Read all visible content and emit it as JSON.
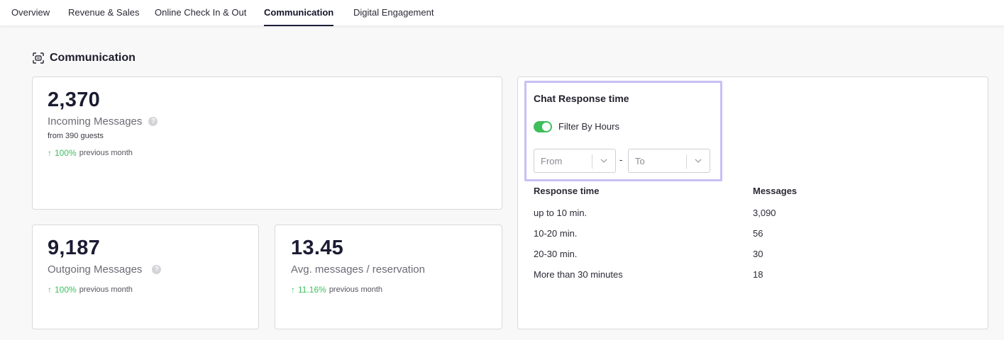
{
  "tabs": [
    {
      "label": "Overview"
    },
    {
      "label": "Revenue & Sales"
    },
    {
      "label": "Online Check In & Out"
    },
    {
      "label": "Communication"
    },
    {
      "label": "Digital Engagement"
    }
  ],
  "section": {
    "title": "Communication",
    "icon": "chat-frame-icon"
  },
  "incoming": {
    "value": "2,370",
    "label": "Incoming Messages",
    "note": "from 390 guests",
    "trend_arrow": "↑",
    "trend_pct": "100%",
    "trend_period": "previous month"
  },
  "outgoing": {
    "value": "9,187",
    "label": "Outgoing Messages",
    "trend_arrow": "↑",
    "trend_pct": "100%",
    "trend_period": "previous month"
  },
  "avg": {
    "value": "13.45",
    "label": "Avg. messages / reservation",
    "trend_arrow": "↑",
    "trend_pct": "11.16%",
    "trend_period": "previous month"
  },
  "chat": {
    "title": "Chat Response time",
    "filter_label": "Filter By Hours",
    "filter_enabled": true,
    "from_placeholder": "From",
    "separator": "-",
    "to_placeholder": "To",
    "columns": [
      "Response time",
      "Messages"
    ],
    "rows": [
      {
        "time": "up to 10 min.",
        "messages": "3,090"
      },
      {
        "time": "10-20 min.",
        "messages": "56"
      },
      {
        "time": "20-30 min.",
        "messages": "30"
      },
      {
        "time": "More than 30 minutes",
        "messages": "18"
      }
    ]
  },
  "colors": {
    "accent_green": "#3cbf5e",
    "toggle_green": "#3fbe5c",
    "highlight_purple": "#c9bff5",
    "active_tab_underline": "#1b1b3a"
  }
}
